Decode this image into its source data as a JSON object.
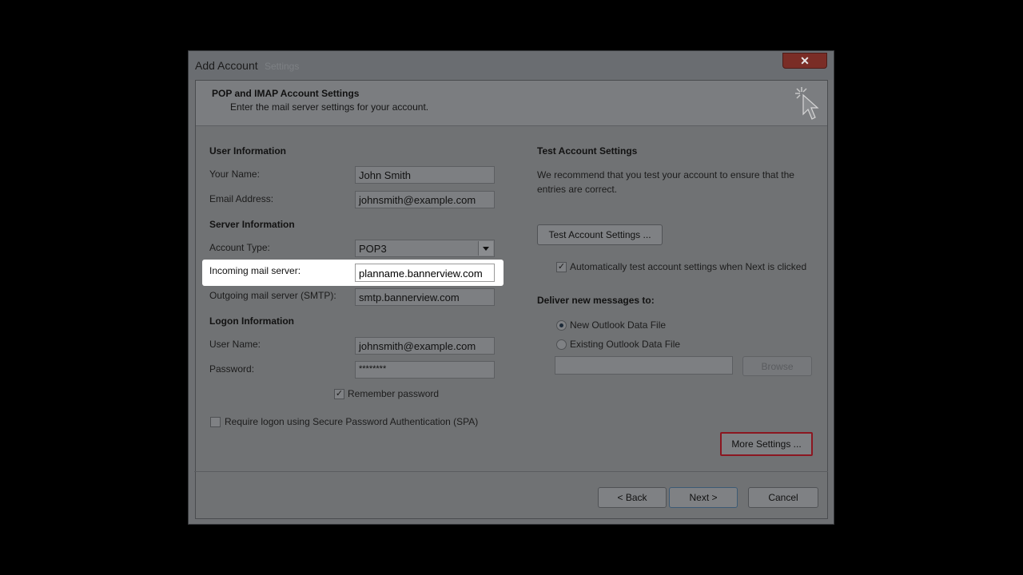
{
  "window": {
    "title": "Add Account",
    "title_ghost": "Settings",
    "close_glyph": "✕"
  },
  "header": {
    "title": "POP and IMAP Account Settings",
    "subtitle": "Enter the mail server settings for your account.",
    "icon": "cursor-sparkle-icon"
  },
  "user_info": {
    "section": "User Information",
    "name_label": "Your Name:",
    "name_value": "John Smith",
    "email_label": "Email Address:",
    "email_value": "johnsmith@example.com"
  },
  "server_info": {
    "section": "Server Information",
    "account_type_label": "Account Type:",
    "account_type_value": "POP3",
    "incoming_label": "Incoming mail server:",
    "incoming_value": "planname.bannerview.com",
    "outgoing_label": "Outgoing mail server (SMTP):",
    "outgoing_value": "smtp.bannerview.com"
  },
  "logon_info": {
    "section": "Logon Information",
    "username_label": "User Name:",
    "username_value": "johnsmith@example.com",
    "password_label": "Password:",
    "password_value": "********",
    "remember_label": "Remember password",
    "spa_label": "Require logon using Secure Password Authentication (SPA)"
  },
  "test_settings": {
    "section": "Test Account Settings",
    "description": "We recommend that you test your account to ensure that the entries are correct.",
    "test_button": "Test Account Settings ...",
    "auto_test_label": "Automatically test account settings when Next is clicked"
  },
  "deliver": {
    "section": "Deliver new messages to:",
    "new_label": "New Outlook Data File",
    "existing_label": "Existing Outlook Data File",
    "path_value": "",
    "browse_button": "Browse"
  },
  "more_settings_button": "More Settings ...",
  "footer": {
    "back": "< Back",
    "next": "Next >",
    "cancel": "Cancel"
  },
  "colors": {
    "highlight_border": "#8b1620",
    "focus_box": "#ffffff"
  }
}
